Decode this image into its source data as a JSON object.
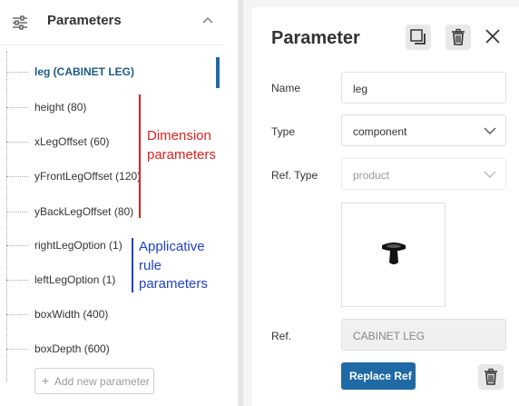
{
  "left_panel": {
    "title": "Parameters",
    "add_button_label": "Add new parameter",
    "parameters": [
      {
        "label": "leg (CABINET LEG)",
        "active": true
      },
      {
        "label": "height (80)"
      },
      {
        "label": "xLegOffset (60)"
      },
      {
        "label": "yFrontLegOffset (120)"
      },
      {
        "label": "yBackLegOffset (80)"
      },
      {
        "label": "rightLegOption (1)"
      },
      {
        "label": "leftLegOption (1)"
      },
      {
        "label": "boxWidth (400)"
      },
      {
        "label": "boxDepth (600)"
      }
    ]
  },
  "annotations": {
    "dimension_line1": "Dimension",
    "dimension_line2": "parameters",
    "applicative_line1": "Applicative",
    "applicative_line2": "rule",
    "applicative_line3": "parameters",
    "dimension_color": "#e02020",
    "applicative_color": "#2040d0"
  },
  "right_panel": {
    "title": "Parameter",
    "name_label": "Name",
    "name_value": "leg",
    "type_label": "Type",
    "type_value": "component",
    "ref_type_label": "Ref. Type",
    "ref_type_value": "product",
    "ref_label": "Ref.",
    "ref_value": "CABINET LEG",
    "replace_button": "Replace Ref"
  },
  "colors": {
    "accent": "#1f6aa5",
    "active_text": "#1c5a86"
  }
}
